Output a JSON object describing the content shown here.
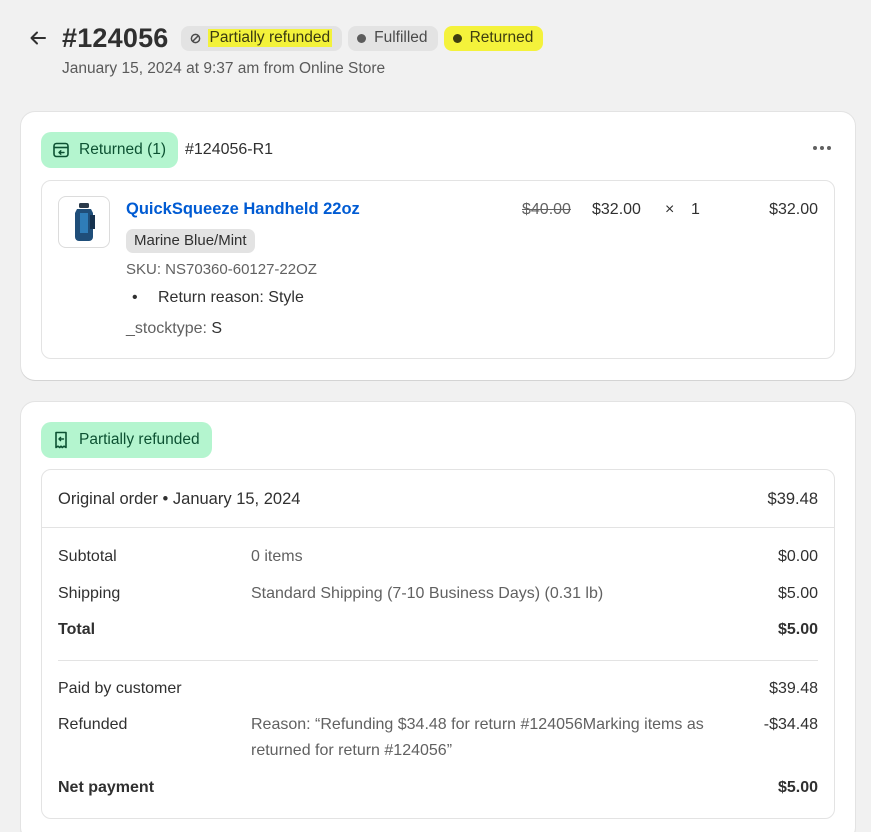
{
  "header": {
    "order_number": "#124056",
    "badges": {
      "partially_refunded": "Partially refunded",
      "fulfilled": "Fulfilled",
      "returned": "Returned"
    },
    "subtitle": "January 15, 2024 at 9:37 am from Online Store"
  },
  "return_card": {
    "status_label": "Returned (1)",
    "return_id": "#124056-R1",
    "item": {
      "name": "QuickSqueeze Handheld 22oz",
      "variant": "Marine Blue/Mint",
      "sku": "SKU: NS70360-60127-22OZ",
      "return_reason": "Return reason: Style",
      "stocktype_key": "_stocktype:",
      "stocktype_value": "S",
      "original_price": "$40.00",
      "price": "$32.00",
      "times": "×",
      "quantity": "1",
      "total": "$32.00"
    }
  },
  "refund_card": {
    "status_label": "Partially refunded",
    "original_order_label": "Original order • January 15, 2024",
    "original_order_amount": "$39.48",
    "rows": {
      "subtotal": {
        "label": "Subtotal",
        "desc": "0 items",
        "amount": "$0.00"
      },
      "shipping": {
        "label": "Shipping",
        "desc": "Standard Shipping (7-10 Business Days) (0.31 lb)",
        "amount": "$5.00"
      },
      "total": {
        "label": "Total",
        "amount": "$5.00"
      },
      "paid": {
        "label": "Paid by customer",
        "amount": "$39.48"
      },
      "refunded": {
        "label": "Refunded",
        "desc": "Reason: “Refunding $34.48 for return #124056Marking items as returned for return #124056”",
        "amount": "-$34.48"
      },
      "net": {
        "label": "Net payment",
        "amount": "$5.00"
      }
    }
  },
  "colors": {
    "success_bg": "#b4f5cf",
    "highlight": "#f3f23a",
    "link": "#005bd3"
  }
}
